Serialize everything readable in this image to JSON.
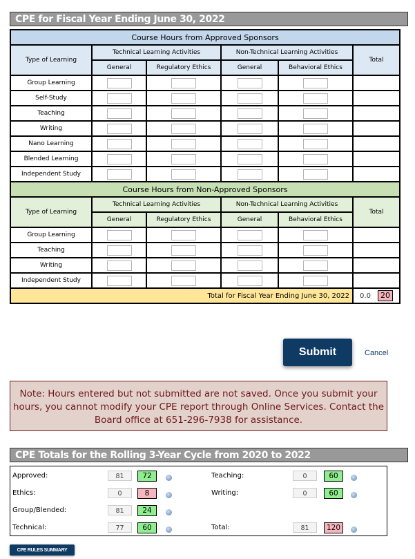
{
  "fiscal": {
    "title": "CPE for Fiscal Year Ending June 30, 2022",
    "approved": {
      "band_label": "Course Hours from Approved Sponsors",
      "type_label": "Type of Learning",
      "technical_label": "Technical Learning Activities",
      "nontechnical_label": "Non-Technical Learning Activities",
      "total_label": "Total",
      "cols": [
        "General",
        "Regulatory Ethics",
        "General",
        "Behavioral Ethics"
      ],
      "rows": [
        {
          "label": "Group Learning",
          "values": [
            "",
            "",
            "",
            ""
          ],
          "total": ""
        },
        {
          "label": "Self-Study",
          "values": [
            "",
            "",
            "",
            ""
          ],
          "total": ""
        },
        {
          "label": "Teaching",
          "values": [
            "",
            "",
            "",
            ""
          ],
          "total": ""
        },
        {
          "label": "Writing",
          "values": [
            "",
            "",
            "",
            ""
          ],
          "total": ""
        },
        {
          "label": "Nano Learning",
          "values": [
            "",
            "",
            "",
            ""
          ],
          "total": ""
        },
        {
          "label": "Blended Learning",
          "values": [
            "",
            "",
            "",
            ""
          ],
          "total": ""
        },
        {
          "label": "Independent Study",
          "values": [
            "",
            "",
            "",
            ""
          ],
          "total": ""
        }
      ]
    },
    "nonapproved": {
      "band_label": "Course Hours from Non-Approved Sponsors",
      "type_label": "Type of Learning",
      "technical_label": "Technical Learning Activities",
      "nontechnical_label": "Non-Technical Learning Activities",
      "total_label": "Total",
      "cols": [
        "General",
        "Regulatory Ethics",
        "General",
        "Behavioral Ethics"
      ],
      "rows": [
        {
          "label": "Group Learning",
          "values": [
            "",
            "",
            "",
            ""
          ],
          "total": ""
        },
        {
          "label": "Teaching",
          "values": [
            "",
            "",
            "",
            ""
          ],
          "total": ""
        },
        {
          "label": "Writing",
          "values": [
            "",
            "",
            "",
            ""
          ],
          "total": ""
        },
        {
          "label": "Independent Study",
          "values": [
            "",
            "",
            "",
            ""
          ],
          "total": ""
        }
      ]
    },
    "total_row": {
      "label": "Total for Fiscal Year Ending June 30, 2022",
      "entered": "0.0",
      "required": "20"
    }
  },
  "actions": {
    "submit_label": "Submit",
    "cancel_label": "Cancel"
  },
  "note": {
    "text": "Note: Hours entered but not submitted are not saved. Once you submit your hours, you cannot modify your CPE report through Online Services. Contact the Board office at 651-296-7938 for assistance."
  },
  "cycle": {
    "title": "CPE Totals for the Rolling 3-Year Cycle from 2020 to 2022",
    "left": [
      {
        "label": "Approved:",
        "current": "81",
        "required": "72",
        "status": "met"
      },
      {
        "label": "Ethics:",
        "current": "0",
        "required": "8",
        "status": "unmet"
      },
      {
        "label": "Group/Blended:",
        "current": "81",
        "required": "24",
        "status": "met"
      },
      {
        "label": "Technical:",
        "current": "77",
        "required": "60",
        "status": "met"
      }
    ],
    "right": [
      {
        "label": "Teaching:",
        "current": "0",
        "required": "60",
        "status": "met"
      },
      {
        "label": "Writing:",
        "current": "0",
        "required": "60",
        "status": "met"
      },
      {
        "label": "Total:",
        "current": "81",
        "required": "120",
        "status": "unmet"
      }
    ]
  },
  "rules_button_label": "CPE RULES SUMMARY",
  "colors": {
    "header_gray": "#999999",
    "approved_band": "#c3d7ec",
    "nonapproved_band": "#c6e0b4",
    "total_band": "#ffe699",
    "met_green": "#90ee90",
    "unmet_pink": "#f7b5c0",
    "button_navy": "#0f3a63",
    "note_bg": "#e3d1cc",
    "note_text": "#6f1a1a"
  }
}
